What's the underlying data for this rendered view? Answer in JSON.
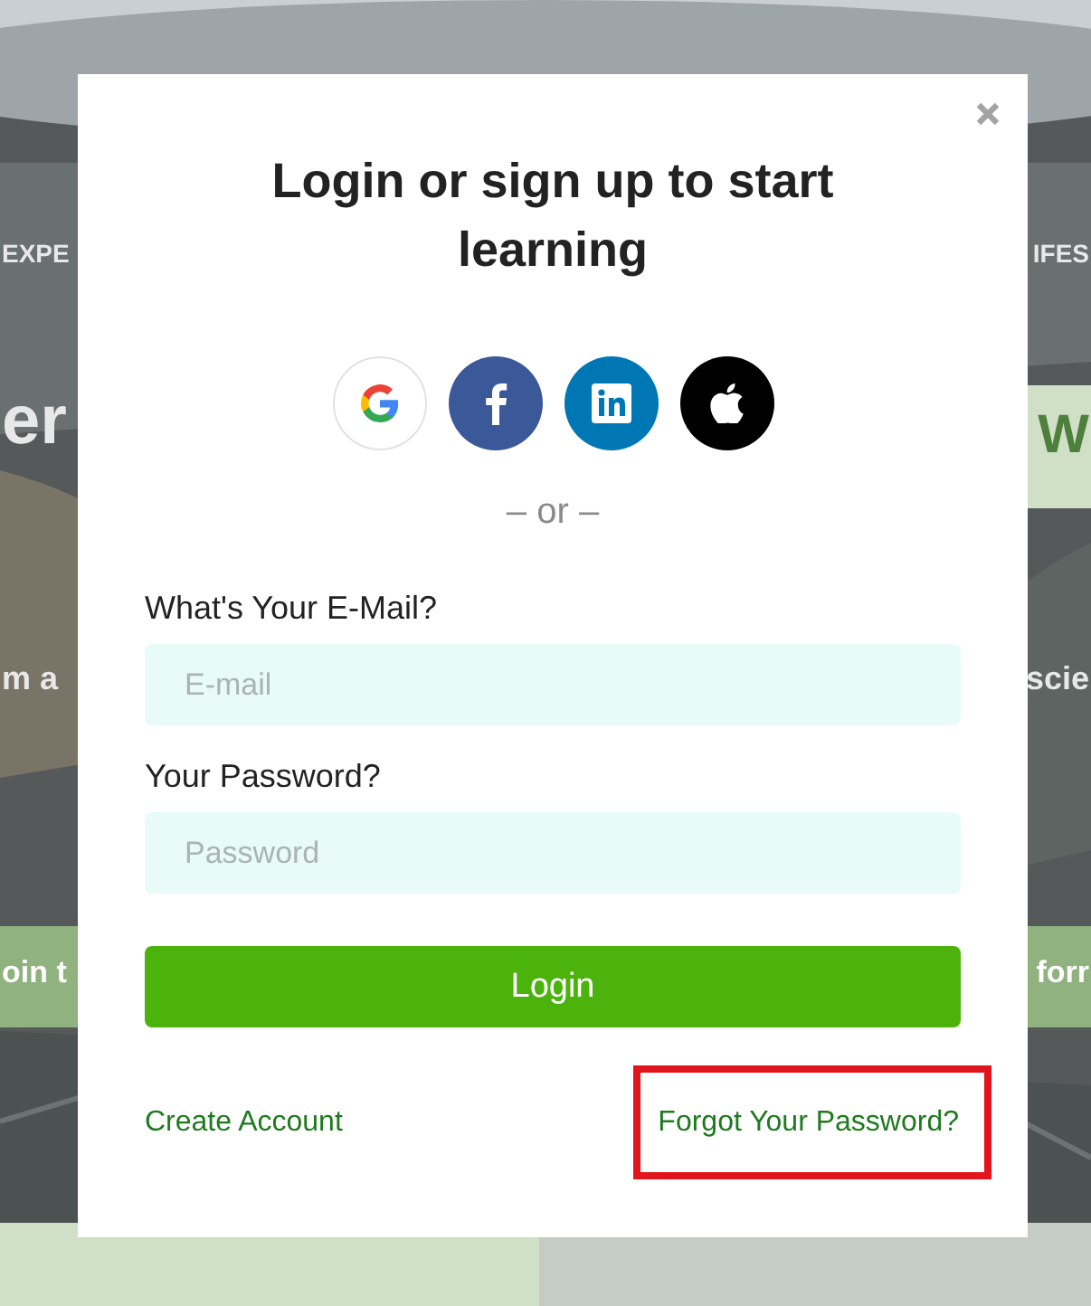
{
  "background": {
    "fragments": [
      {
        "text": "EXPE",
        "kind": "caps"
      },
      {
        "text": "IFES",
        "kind": "caps"
      },
      {
        "text": "er",
        "kind": "big"
      },
      {
        "text": "W",
        "kind": "big"
      },
      {
        "text": "m a",
        "kind": "sub"
      },
      {
        "text": "scie",
        "kind": "sub"
      },
      {
        "text": "oin t",
        "kind": "band"
      },
      {
        "text": "forr",
        "kind": "band"
      }
    ]
  },
  "modal": {
    "title": "Login or sign up to start learning",
    "social": [
      {
        "kind": "google"
      },
      {
        "kind": "facebook"
      },
      {
        "kind": "linkedin"
      },
      {
        "kind": "apple"
      }
    ],
    "divider": "– or –",
    "fields": [
      {
        "label": "What's Your E-Mail?",
        "placeholder": "E-mail"
      },
      {
        "label": "Your Password?",
        "placeholder": "Password"
      }
    ],
    "submit": "Login",
    "links": [
      {
        "text": "Create Account",
        "highlighted": false
      },
      {
        "text": "Forgot Your Password?",
        "highlighted": true
      }
    ]
  }
}
